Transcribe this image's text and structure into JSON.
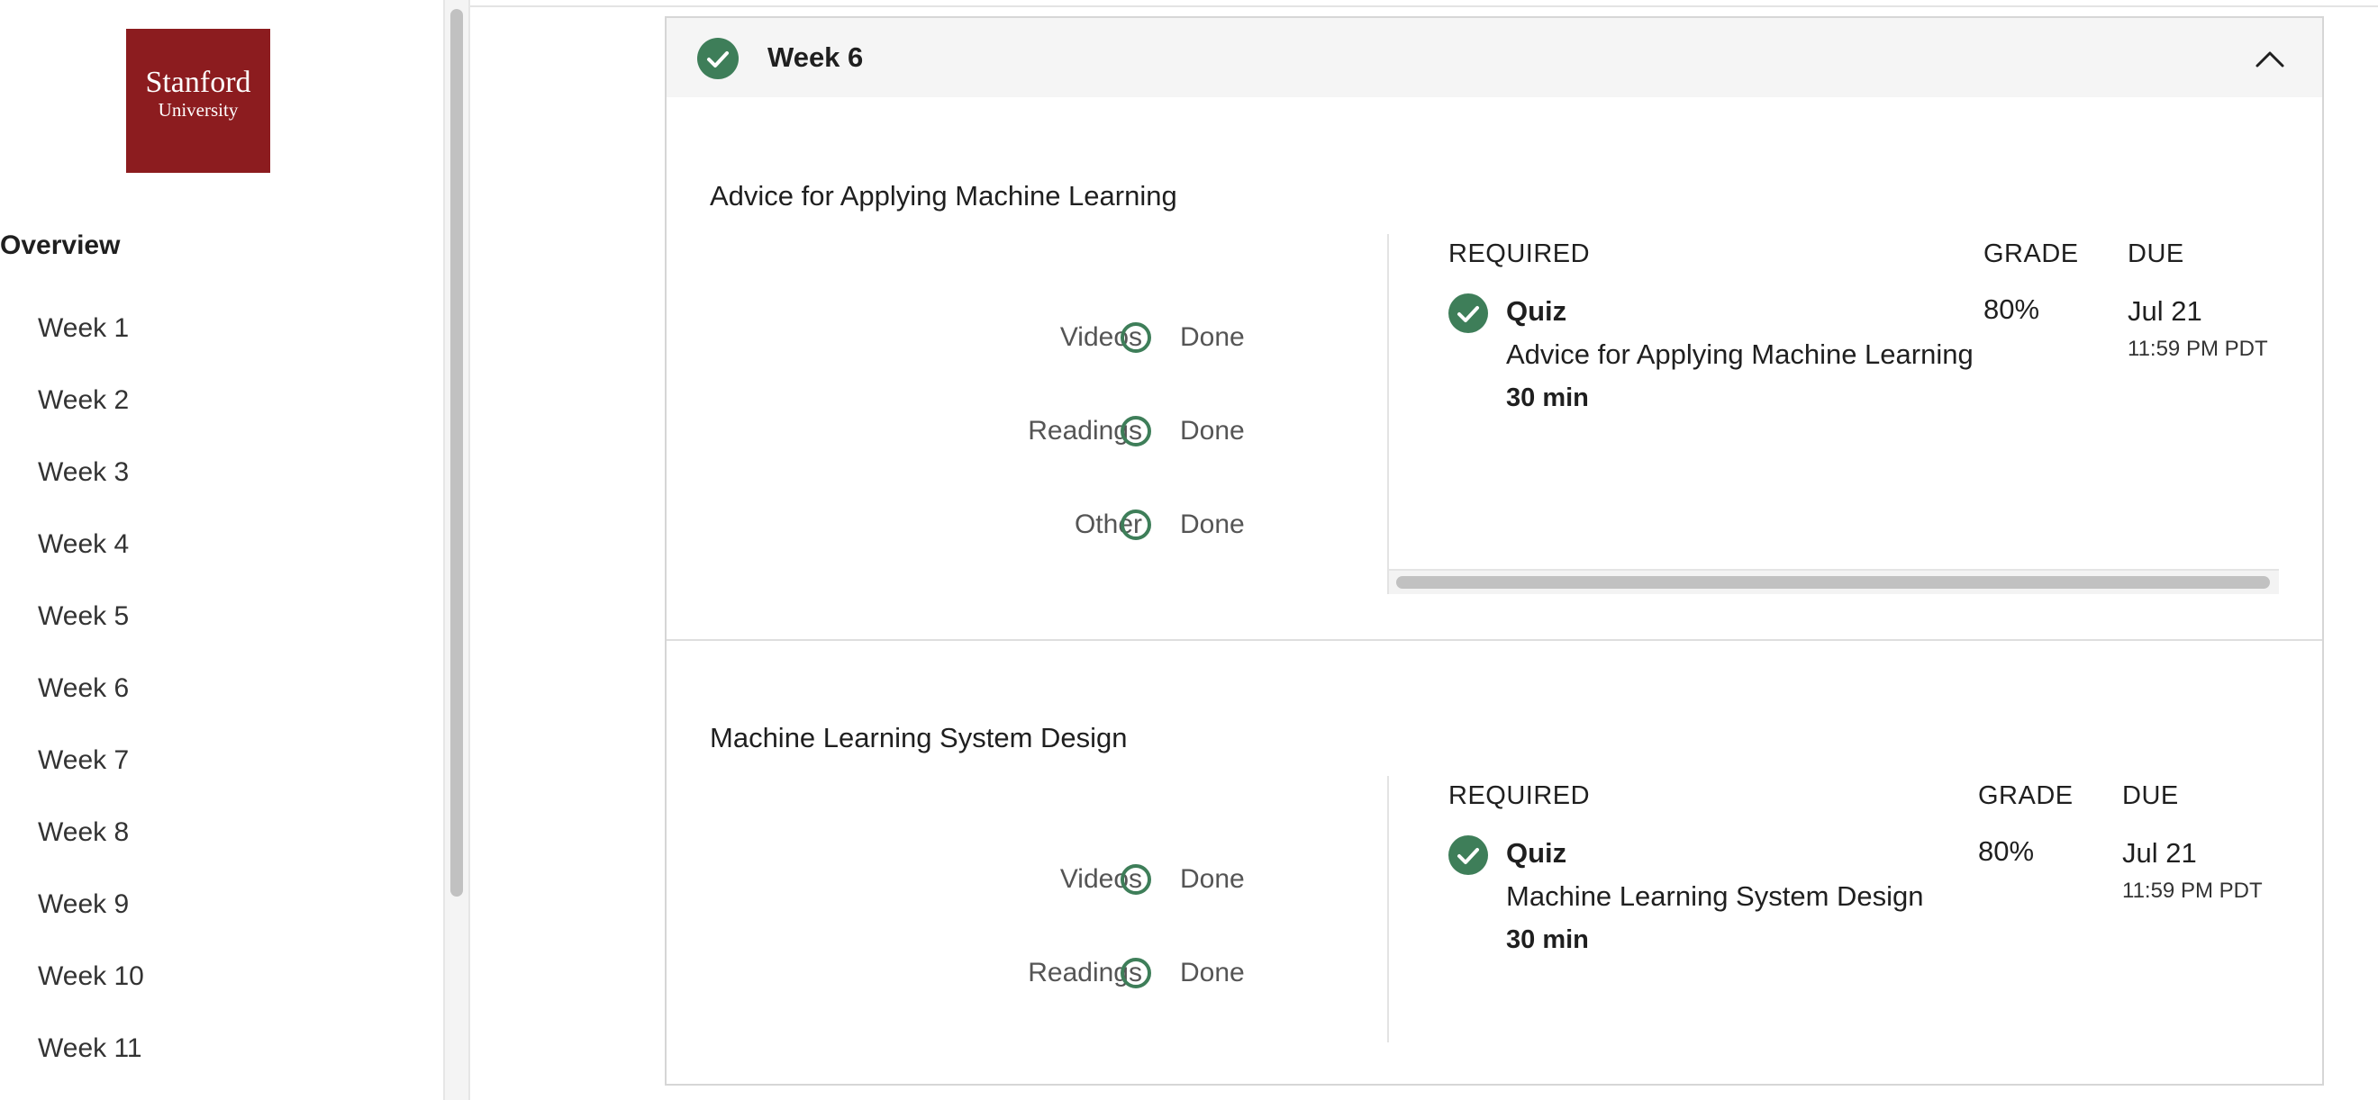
{
  "sidebar": {
    "logo": {
      "line1": "Stanford",
      "line2": "University"
    },
    "overview_label": "Overview",
    "weeks": [
      "Week 1",
      "Week 2",
      "Week 3",
      "Week 4",
      "Week 5",
      "Week 6",
      "Week 7",
      "Week 8",
      "Week 9",
      "Week 10",
      "Week 11"
    ]
  },
  "week": {
    "title": "Week 6",
    "collapse_icon": "chevron-up-icon",
    "completed_icon": "check-icon",
    "sections": [
      {
        "title": "Advice for Applying Machine Learning",
        "progress": [
          {
            "type": "Videos",
            "status": "Done"
          },
          {
            "type": "Readings",
            "status": "Done"
          },
          {
            "type": "Other",
            "status": "Done"
          }
        ],
        "table_headers": {
          "required": "REQUIRED",
          "grade": "GRADE",
          "due": "DUE"
        },
        "item": {
          "kind": "Quiz",
          "name": "Advice for Applying Machine Learning",
          "duration": "30 min",
          "grade": "80%",
          "due_date": "Jul 21",
          "due_time": "11:59 PM PDT"
        }
      },
      {
        "title": "Machine Learning System Design",
        "progress": [
          {
            "type": "Videos",
            "status": "Done"
          },
          {
            "type": "Readings",
            "status": "Done"
          }
        ],
        "table_headers": {
          "required": "REQUIRED",
          "grade": "GRADE",
          "due": "DUE"
        },
        "item": {
          "kind": "Quiz",
          "name": "Machine Learning System Design",
          "duration": "30 min",
          "grade": "80%",
          "due_date": "Jul 21",
          "due_time": "11:59 PM PDT"
        }
      }
    ]
  },
  "colors": {
    "accent_green": "#3e7e59",
    "brand_red": "#8c1c1f"
  }
}
